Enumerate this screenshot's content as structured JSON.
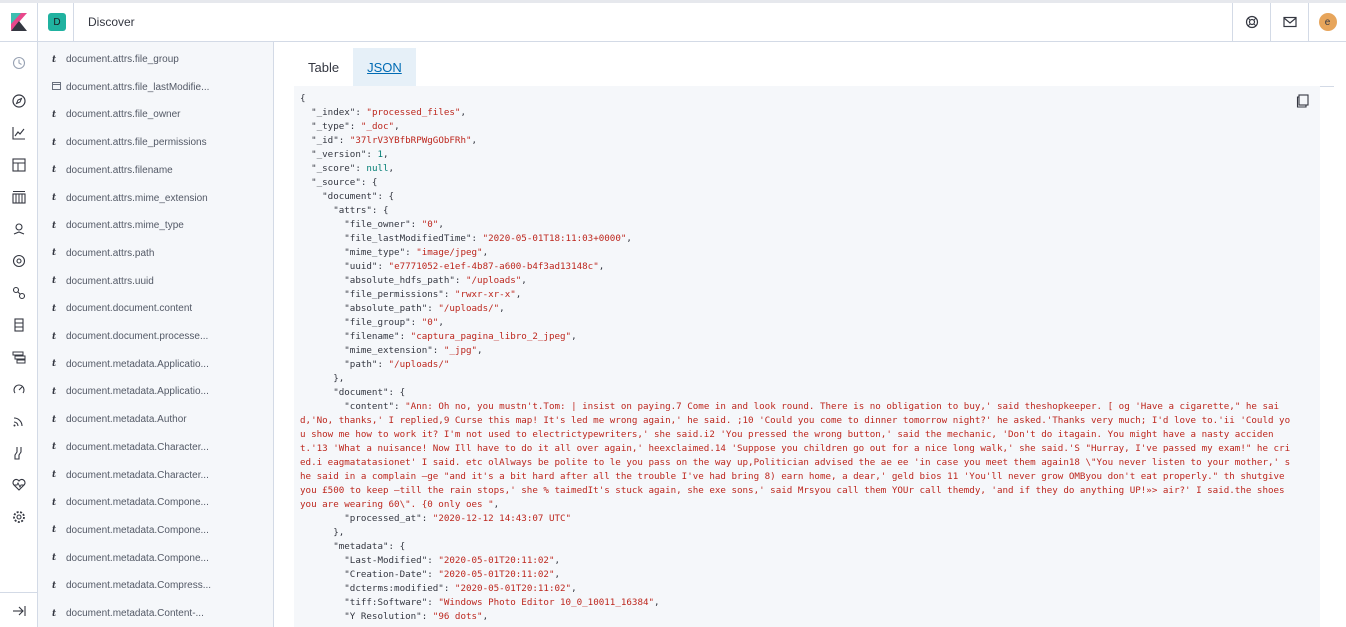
{
  "header": {
    "space_initial": "D",
    "app_title": "Discover",
    "user_initial": "e"
  },
  "nav_icons": [
    "clock-icon",
    "compass-icon",
    "visualize-icon",
    "dashboard-icon",
    "canvas-icon",
    "maps-icon",
    "ml-icon",
    "graph-icon",
    "infrastructure-icon",
    "logs-icon",
    "apm-icon",
    "uptime-icon",
    "siem-icon",
    "dev-tools-icon",
    "monitoring-icon",
    "management-icon",
    "collapse-icon"
  ],
  "fields": [
    {
      "type": "t",
      "name": "document.attrs.file_group"
    },
    {
      "type": "date",
      "name": "document.attrs.file_lastModifie..."
    },
    {
      "type": "t",
      "name": "document.attrs.file_owner"
    },
    {
      "type": "t",
      "name": "document.attrs.file_permissions"
    },
    {
      "type": "t",
      "name": "document.attrs.filename"
    },
    {
      "type": "t",
      "name": "document.attrs.mime_extension"
    },
    {
      "type": "t",
      "name": "document.attrs.mime_type"
    },
    {
      "type": "t",
      "name": "document.attrs.path"
    },
    {
      "type": "t",
      "name": "document.attrs.uuid"
    },
    {
      "type": "t",
      "name": "document.document.content"
    },
    {
      "type": "t",
      "name": "document.document.processe..."
    },
    {
      "type": "t",
      "name": "document.metadata.Applicatio..."
    },
    {
      "type": "t",
      "name": "document.metadata.Applicatio..."
    },
    {
      "type": "t",
      "name": "document.metadata.Author"
    },
    {
      "type": "t",
      "name": "document.metadata.Character..."
    },
    {
      "type": "t",
      "name": "document.metadata.Character..."
    },
    {
      "type": "t",
      "name": "document.metadata.Compone..."
    },
    {
      "type": "t",
      "name": "document.metadata.Compone..."
    },
    {
      "type": "t",
      "name": "document.metadata.Compone..."
    },
    {
      "type": "t",
      "name": "document.metadata.Compress..."
    },
    {
      "type": "t",
      "name": "document.metadata.Content-..."
    }
  ],
  "tabs": {
    "table": "Table",
    "json": "JSON"
  },
  "json_lines": [
    [
      [
        "k",
        "{"
      ]
    ],
    [
      [
        "k",
        "  \"_index\": "
      ],
      [
        "s",
        "\"processed_files\""
      ],
      [
        "k",
        ","
      ]
    ],
    [
      [
        "k",
        "  \"_type\": "
      ],
      [
        "s",
        "\"_doc\""
      ],
      [
        "k",
        ","
      ]
    ],
    [
      [
        "k",
        "  \"_id\": "
      ],
      [
        "s",
        "\"37lrV3YBfbRPWgGObFRh\""
      ],
      [
        "k",
        ","
      ]
    ],
    [
      [
        "k",
        "  \"_version\": "
      ],
      [
        "n",
        "1"
      ],
      [
        "k",
        ","
      ]
    ],
    [
      [
        "k",
        "  \"_score\": "
      ],
      [
        "n",
        "null"
      ],
      [
        "k",
        ","
      ]
    ],
    [
      [
        "k",
        "  \"_source\": {"
      ]
    ],
    [
      [
        "k",
        "    \"document\": {"
      ]
    ],
    [
      [
        "k",
        "      \"attrs\": {"
      ]
    ],
    [
      [
        "k",
        "        \"file_owner\": "
      ],
      [
        "s",
        "\"0\""
      ],
      [
        "k",
        ","
      ]
    ],
    [
      [
        "k",
        "        \"file_lastModifiedTime\": "
      ],
      [
        "s",
        "\"2020-05-01T18:11:03+0000\""
      ],
      [
        "k",
        ","
      ]
    ],
    [
      [
        "k",
        "        \"mime_type\": "
      ],
      [
        "s",
        "\"image/jpeg\""
      ],
      [
        "k",
        ","
      ]
    ],
    [
      [
        "k",
        "        \"uuid\": "
      ],
      [
        "s",
        "\"e7771052-e1ef-4b87-a600-b4f3ad13148c\""
      ],
      [
        "k",
        ","
      ]
    ],
    [
      [
        "k",
        "        \"absolute_hdfs_path\": "
      ],
      [
        "s",
        "\"/uploads\""
      ],
      [
        "k",
        ","
      ]
    ],
    [
      [
        "k",
        "        \"file_permissions\": "
      ],
      [
        "s",
        "\"rwxr-xr-x\""
      ],
      [
        "k",
        ","
      ]
    ],
    [
      [
        "k",
        "        \"absolute_path\": "
      ],
      [
        "s",
        "\"/uploads/\""
      ],
      [
        "k",
        ","
      ]
    ],
    [
      [
        "k",
        "        \"file_group\": "
      ],
      [
        "s",
        "\"0\""
      ],
      [
        "k",
        ","
      ]
    ],
    [
      [
        "k",
        "        \"filename\": "
      ],
      [
        "s",
        "\"captura_pagina_libro_2_jpeg\""
      ],
      [
        "k",
        ","
      ]
    ],
    [
      [
        "k",
        "        \"mime_extension\": "
      ],
      [
        "s",
        "\"_jpg\""
      ],
      [
        "k",
        ","
      ]
    ],
    [
      [
        "k",
        "        \"path\": "
      ],
      [
        "s",
        "\"/uploads/\""
      ]
    ],
    [
      [
        "k",
        "      },"
      ]
    ],
    [
      [
        "k",
        "      \"document\": {"
      ]
    ],
    [
      [
        "k",
        "        \"content\": "
      ],
      [
        "s",
        "\"Ann: Oh no, you mustn't.Tom: | insist on paying.7 Come in and look round. There is no obligation to buy,' said theshopkeeper. [ og 'Have a cigarette,\" he said,'No, thanks,' I replied,9 Curse this map! It's led me wrong again,' he said. ;10 'Could you come to dinner tomorrow night?' he asked.'Thanks very much; I'd love to.'ii 'Could you show me how to work it? I'm not used to electrictypewriters,' she said.i2 'You pressed the wrong button,' said the mechanic, 'Don't do itagain. You might have a nasty accident.'13 'What a nuisance! Now Ill have to do it all over again,' heexclaimed.14 'Suppose you children go out for a nice long walk,' she said.'S \"Hurray, I've passed my exam!\" he cried.i eagmatatasionet' I said. etc olAlways be polite to le you pass on the way up,Politician advised the ae ee 'in case you meet them again18 \\\"You never listen to your mother,' she said in a complain –ge \"and it's a bit hard after all the trouble I've had bring 8) earn home, a dear,' geld bios 11 'You'll never grow OMByou don't eat properly.\" th shutgive you £500 to keep –till the rain stops,' she % taimedIt's stuck again, she exe sons,' said Mrsyou call them YOUr call themdy, 'and if they do anything UP!»> air?' I said.the shoes you are wearing 60\\\". {0 only oes \""
      ],
      [
        "k",
        ","
      ]
    ],
    [
      [
        "k",
        "        \"processed_at\": "
      ],
      [
        "s",
        "\"2020-12-12 14:43:07 UTC\""
      ]
    ],
    [
      [
        "k",
        "      },"
      ]
    ],
    [
      [
        "k",
        "      \"metadata\": {"
      ]
    ],
    [
      [
        "k",
        "        \"Last-Modified\": "
      ],
      [
        "s",
        "\"2020-05-01T20:11:02\""
      ],
      [
        "k",
        ","
      ]
    ],
    [
      [
        "k",
        "        \"Creation-Date\": "
      ],
      [
        "s",
        "\"2020-05-01T20:11:02\""
      ],
      [
        "k",
        ","
      ]
    ],
    [
      [
        "k",
        "        \"dcterms:modified\": "
      ],
      [
        "s",
        "\"2020-05-01T20:11:02\""
      ],
      [
        "k",
        ","
      ]
    ],
    [
      [
        "k",
        "        \"tiff:Software\": "
      ],
      [
        "s",
        "\"Windows Photo Editor 10_0_10011_16384\""
      ],
      [
        "k",
        ","
      ]
    ],
    [
      [
        "k",
        "        \"Y Resolution\": "
      ],
      [
        "s",
        "\"96 dots\""
      ],
      [
        "k",
        ","
      ]
    ]
  ]
}
